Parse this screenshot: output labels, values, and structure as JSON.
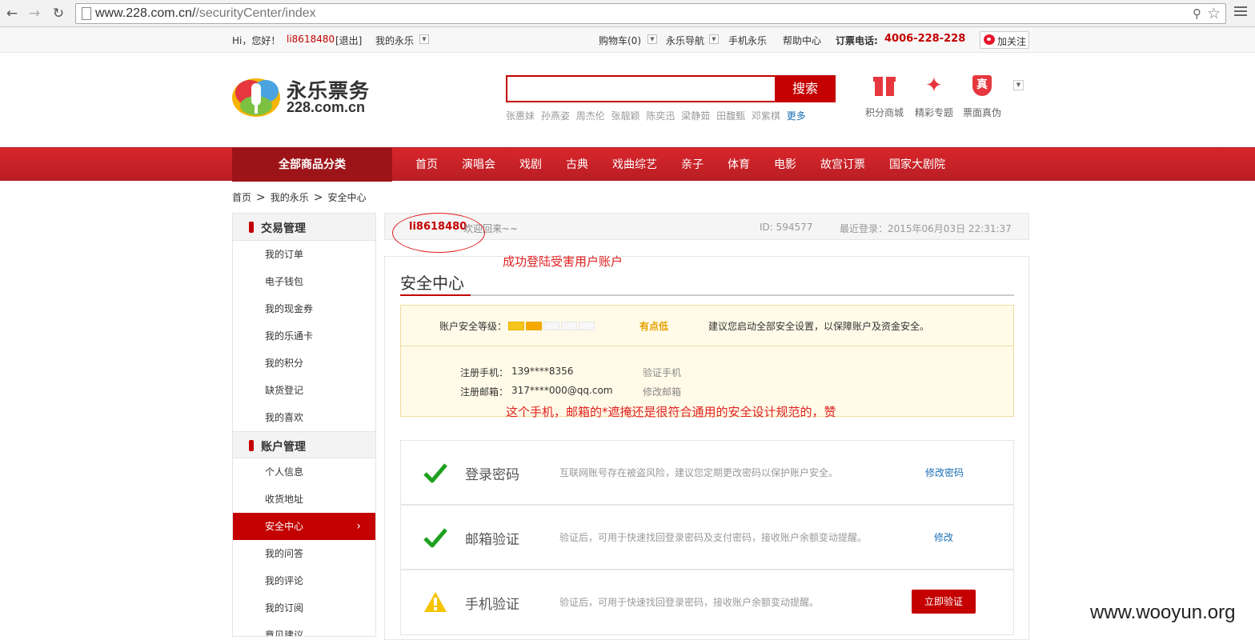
{
  "browser": {
    "url_host": "www.228.com.cn/",
    "url_path": "/securityCenter/index"
  },
  "topbar": {
    "greeting": "Hi，您好！",
    "username": "li8618480",
    "logout": "[退出]",
    "my_account": "我的永乐",
    "cart": "购物车(0)",
    "site_nav": "永乐导航",
    "mobile": "手机永乐",
    "help": "帮助中心",
    "hotline_label": "订票电话:",
    "hotline": "4006-228-228",
    "follow": "加关注"
  },
  "header": {
    "logo_name": "永乐票务",
    "logo_domain": "228.com.cn",
    "search_button": "搜索",
    "hot_words": [
      "张惠妹",
      "孙燕姿",
      "周杰伦",
      "张靓颖",
      "陈奕迅",
      "梁静茹",
      "田馥甄",
      "邓紫棋"
    ],
    "more": "更多",
    "quick_links": [
      {
        "label": "积分商城",
        "icon": "gift-icon"
      },
      {
        "label": "精彩专题",
        "icon": "magic-wand-icon"
      },
      {
        "label": "票面真伪",
        "icon": "authenticity-shield-icon"
      }
    ],
    "shield_char": "真"
  },
  "mainnav": {
    "all_categories": "全部商品分类",
    "items": [
      "首页",
      "演唱会",
      "戏剧",
      "古典",
      "戏曲综艺",
      "亲子",
      "体育",
      "电影",
      "故宫订票",
      "国家大剧院"
    ]
  },
  "breadcrumb": [
    "首页",
    "我的永乐",
    "安全中心"
  ],
  "sidebar": {
    "groups": [
      {
        "title": "交易管理",
        "items": [
          "我的订单",
          "电子钱包",
          "我的现金券",
          "我的乐通卡",
          "我的积分",
          "缺货登记",
          "我的喜欢"
        ]
      },
      {
        "title": "账户管理",
        "items": [
          "个人信息",
          "收货地址",
          "安全中心",
          "我的问答",
          "我的评论",
          "我的订阅",
          "意见建议"
        ]
      }
    ],
    "active_item": "安全中心"
  },
  "welcome": {
    "username": "li8618480",
    "message": "欢迎回来~~",
    "id_text": "ID: 594577",
    "last_login": "最近登录：2015年06月03日 22:31:37"
  },
  "annotations": {
    "login_success": "成功登陆受害用户账户",
    "masking_note": "这个手机，邮箱的*遮掩还是很符合通用的安全设计规范的，赞"
  },
  "security": {
    "title": "安全中心",
    "level_label": "账户安全等级：",
    "level_filled_segments": 2,
    "level_total_segments": 5,
    "level_word": "有点低",
    "level_advice": "建议您启动全部安全设置，以保障账户及资金安全。",
    "phone_label": "注册手机：",
    "phone_value": "139****8356",
    "phone_action": "验证手机",
    "email_label": "注册邮箱：",
    "email_value": "317****000@qq.com",
    "email_action": "修改邮箱",
    "rows": [
      {
        "name": "登录密码",
        "desc": "互联网账号存在被盗风险，建议您定期更改密码以保护账户安全。",
        "action": "修改密码",
        "status": "ok"
      },
      {
        "name": "邮箱验证",
        "desc": "验证后，可用于快速找回登录密码及支付密码，接收账户余额变动提醒。",
        "action": "修改",
        "status": "ok"
      },
      {
        "name": "手机验证",
        "desc": "验证后，可用于快速找回登录密码，接收账户余额变动提醒。",
        "action": "立即验证",
        "status": "warning"
      }
    ]
  },
  "colors": {
    "brand_red": "#c40000",
    "check_green": "#1fa11f",
    "warning_yellow": "#f5c400",
    "meter_fill": "#f7c61a"
  },
  "watermark": "www.wooyun.org"
}
